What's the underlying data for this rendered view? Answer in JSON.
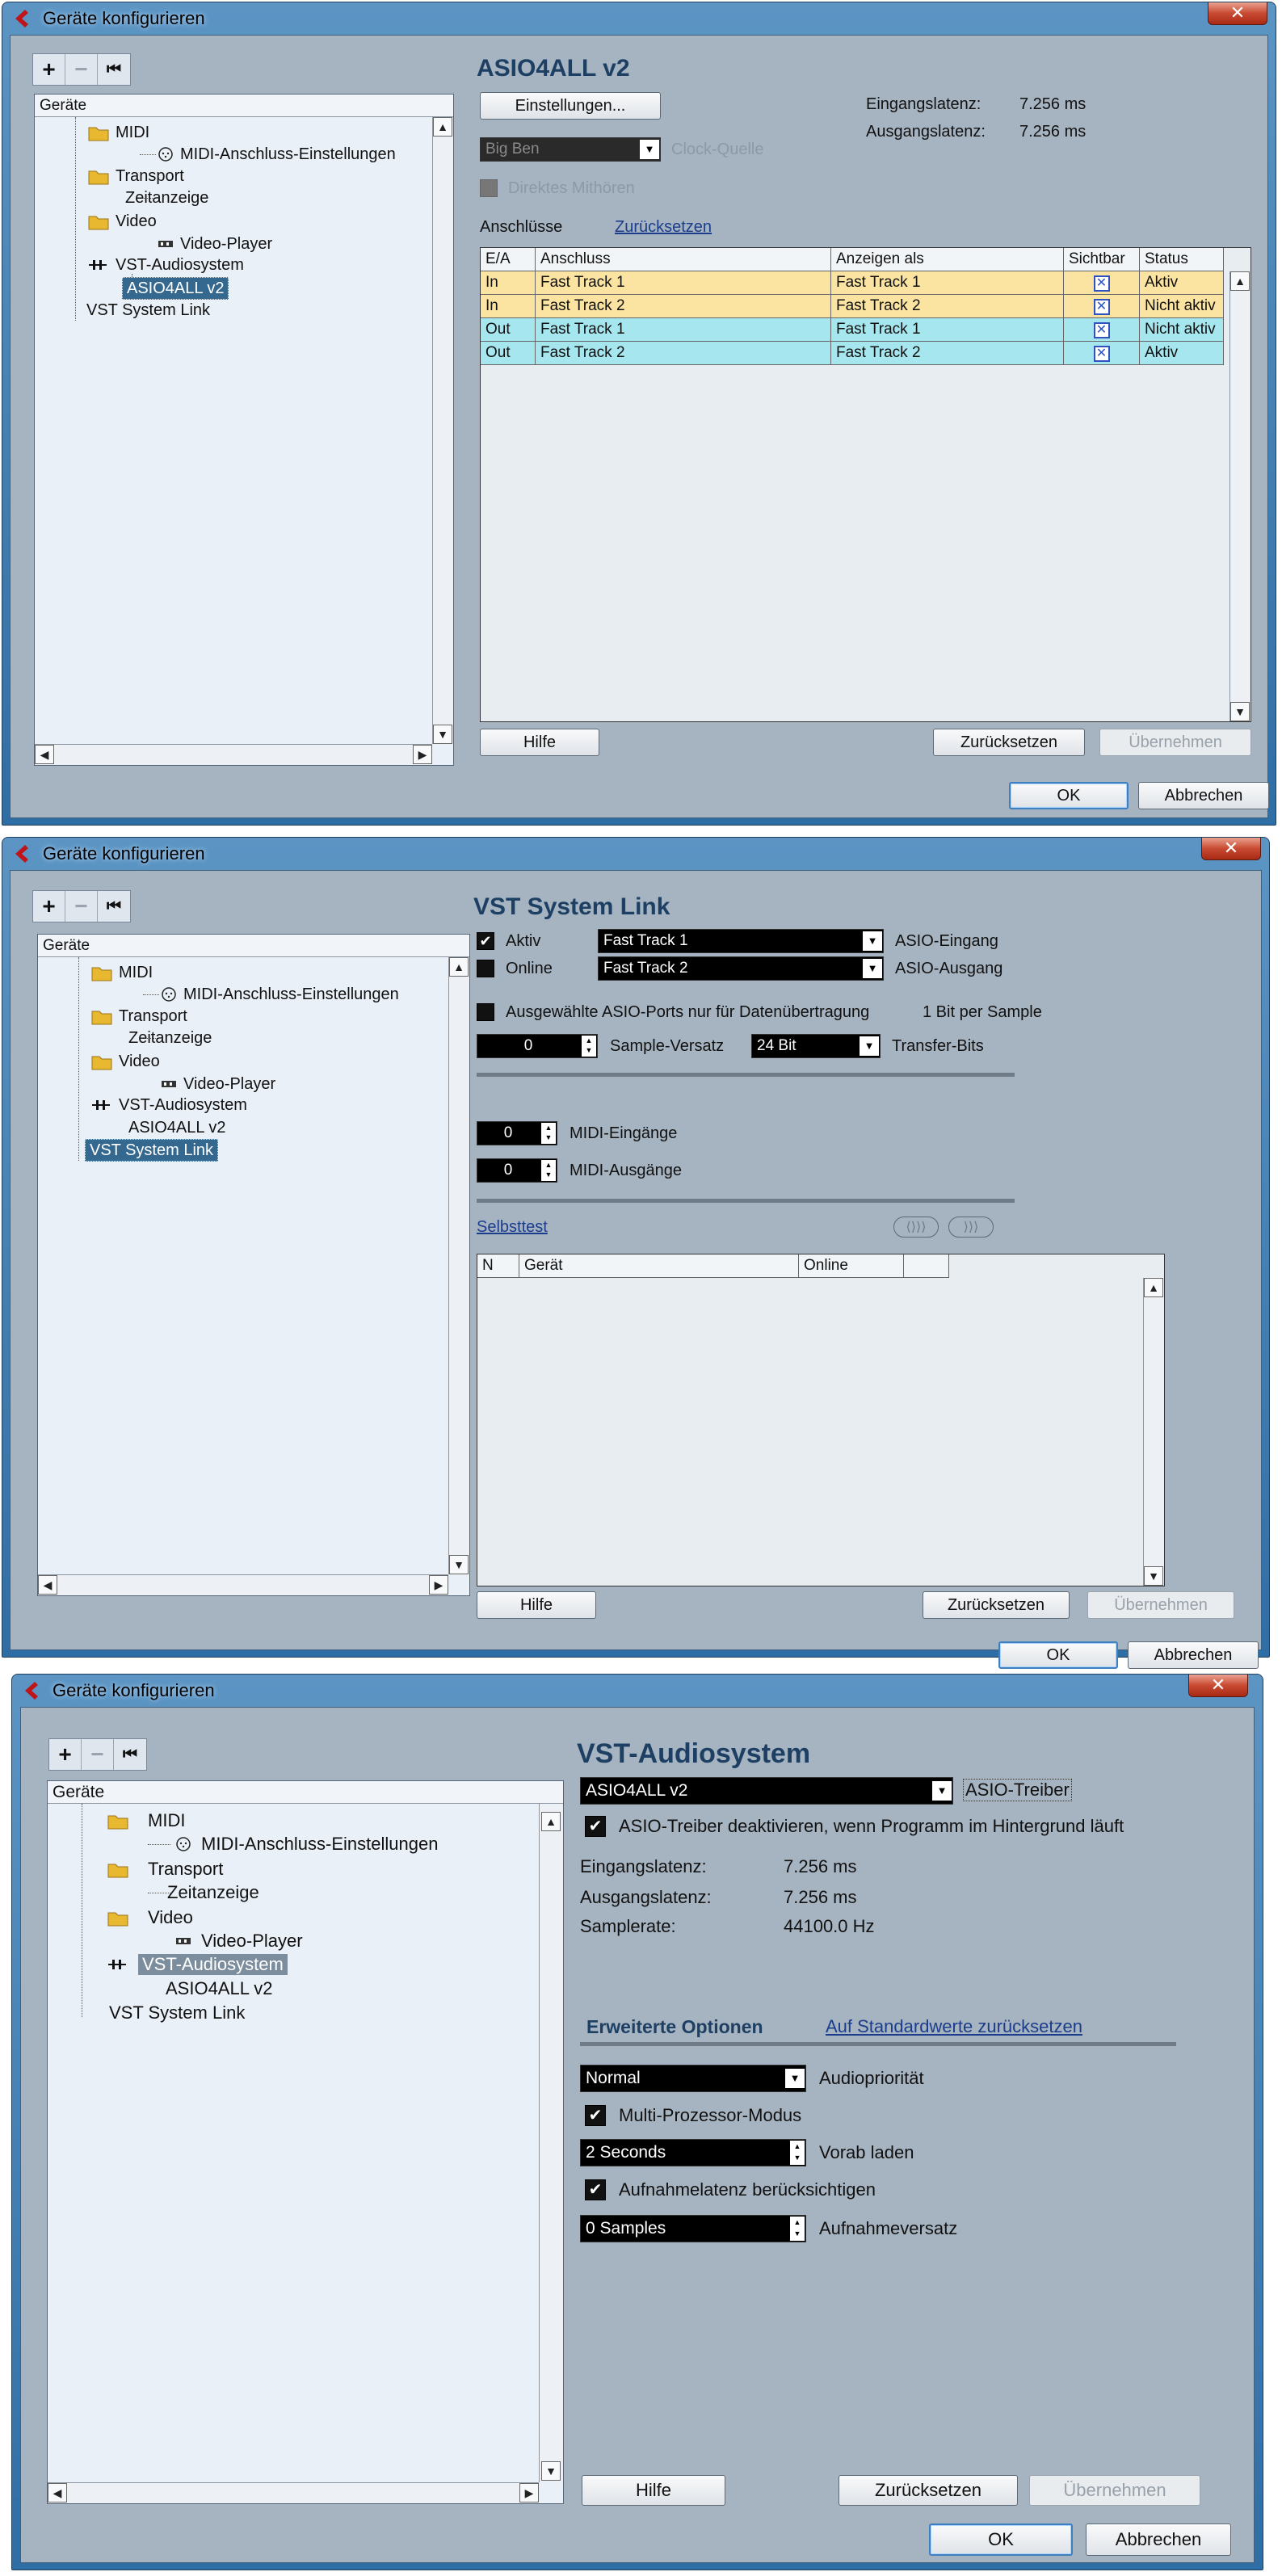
{
  "dialog_title": "Geräte konfigurieren",
  "close_glyph": "✕",
  "toolbar": {
    "add": "+",
    "remove": "−",
    "reset": "⏮"
  },
  "tree": {
    "header": "Geräte",
    "midi": "MIDI",
    "midi_port_setup": "MIDI-Anschluss-Einstellungen",
    "transport": "Transport",
    "time_display": "Zeitanzeige",
    "video": "Video",
    "video_player": "Video-Player",
    "vst_audio": "VST-Audiosystem",
    "asio4all": "ASIO4ALL v2",
    "vst_system_link": "VST System Link"
  },
  "buttons": {
    "help": "Hilfe",
    "reset": "Zurücksetzen",
    "apply": "Übernehmen",
    "ok": "OK",
    "cancel": "Abbrechen"
  },
  "panel1": {
    "title": "ASIO4ALL v2",
    "settings_button": "Einstellungen...",
    "clock_source_value": "Big Ben",
    "clock_source_label": "Clock-Quelle",
    "direct_monitoring": "Direktes Mithören",
    "input_latency_label": "Eingangslatenz:",
    "input_latency_value": "7.256 ms",
    "output_latency_label": "Ausgangslatenz:",
    "output_latency_value": "7.256 ms",
    "ports_label": "Anschlüsse",
    "ports_reset_link": "Zurücksetzen",
    "columns": [
      "E/A",
      "Anschluss",
      "Anzeigen als",
      "Sichtbar",
      "Status"
    ],
    "rows": [
      {
        "io": "In",
        "port": "Fast Track 1",
        "show_as": "Fast Track 1",
        "visible": "✕",
        "status": "Aktiv"
      },
      {
        "io": "In",
        "port": "Fast Track 2",
        "show_as": "Fast Track 2",
        "visible": "✕",
        "status": "Nicht aktiv"
      },
      {
        "io": "Out",
        "port": "Fast Track 1",
        "show_as": "Fast Track 1",
        "visible": "✕",
        "status": "Nicht aktiv"
      },
      {
        "io": "Out",
        "port": "Fast Track 2",
        "show_as": "Fast Track 2",
        "visible": "✕",
        "status": "Aktiv"
      }
    ],
    "row_colors": {
      "in": "#fbe3a1",
      "out": "#a6e6ee"
    }
  },
  "panel2": {
    "title": "VST System Link",
    "active_label": "Aktiv",
    "online_label": "Online",
    "asio_in_value": "Fast Track 1",
    "asio_in_label": "ASIO-Eingang",
    "asio_out_value": "Fast Track 2",
    "asio_out_label": "ASIO-Ausgang",
    "data_only_label": "Ausgewählte ASIO-Ports nur für Datenübertragung",
    "bit_per_sample": "1 Bit per Sample",
    "sample_offset_value": "0",
    "sample_offset_label": "Sample-Versatz",
    "transfer_bits_value": "24 Bit",
    "transfer_bits_label": "Transfer-Bits",
    "midi_in_value": "0",
    "midi_in_label": "MIDI-Eingänge",
    "midi_out_value": "0",
    "midi_out_label": "MIDI-Ausgänge",
    "selftest_link": "Selbsttest",
    "net_btn1": "⟨⟩⟩⟩",
    "net_btn2": "⟩⟩⟩",
    "columns": [
      "N",
      "Gerät",
      "Online",
      ""
    ]
  },
  "panel3": {
    "title": "VST-Audiosystem",
    "driver_value": "ASIO4ALL v2",
    "driver_label": "ASIO-Treiber",
    "deactivate_label": "ASIO-Treiber deaktivieren, wenn Programm im Hintergrund läuft",
    "input_latency_label": "Eingangslatenz:",
    "input_latency_value": "7.256 ms",
    "output_latency_label": "Ausgangslatenz:",
    "output_latency_value": "7.256 ms",
    "samplerate_label": "Samplerate:",
    "samplerate_value": "44100.0 Hz",
    "advanced_tab": "Erweiterte Optionen",
    "defaults_link": "Auf Standardwerte zurücksetzen",
    "priority_value": "Normal",
    "priority_label": "Audiopriorität",
    "multiproc_label": "Multi-Prozessor-Modus",
    "preload_value": "2 Seconds",
    "preload_label": "Vorab laden",
    "rec_latency_label": "Aufnahmelatenz berücksichtigen",
    "rec_offset_value": "0 Samples",
    "rec_offset_label": "Aufnahmeversatz"
  }
}
